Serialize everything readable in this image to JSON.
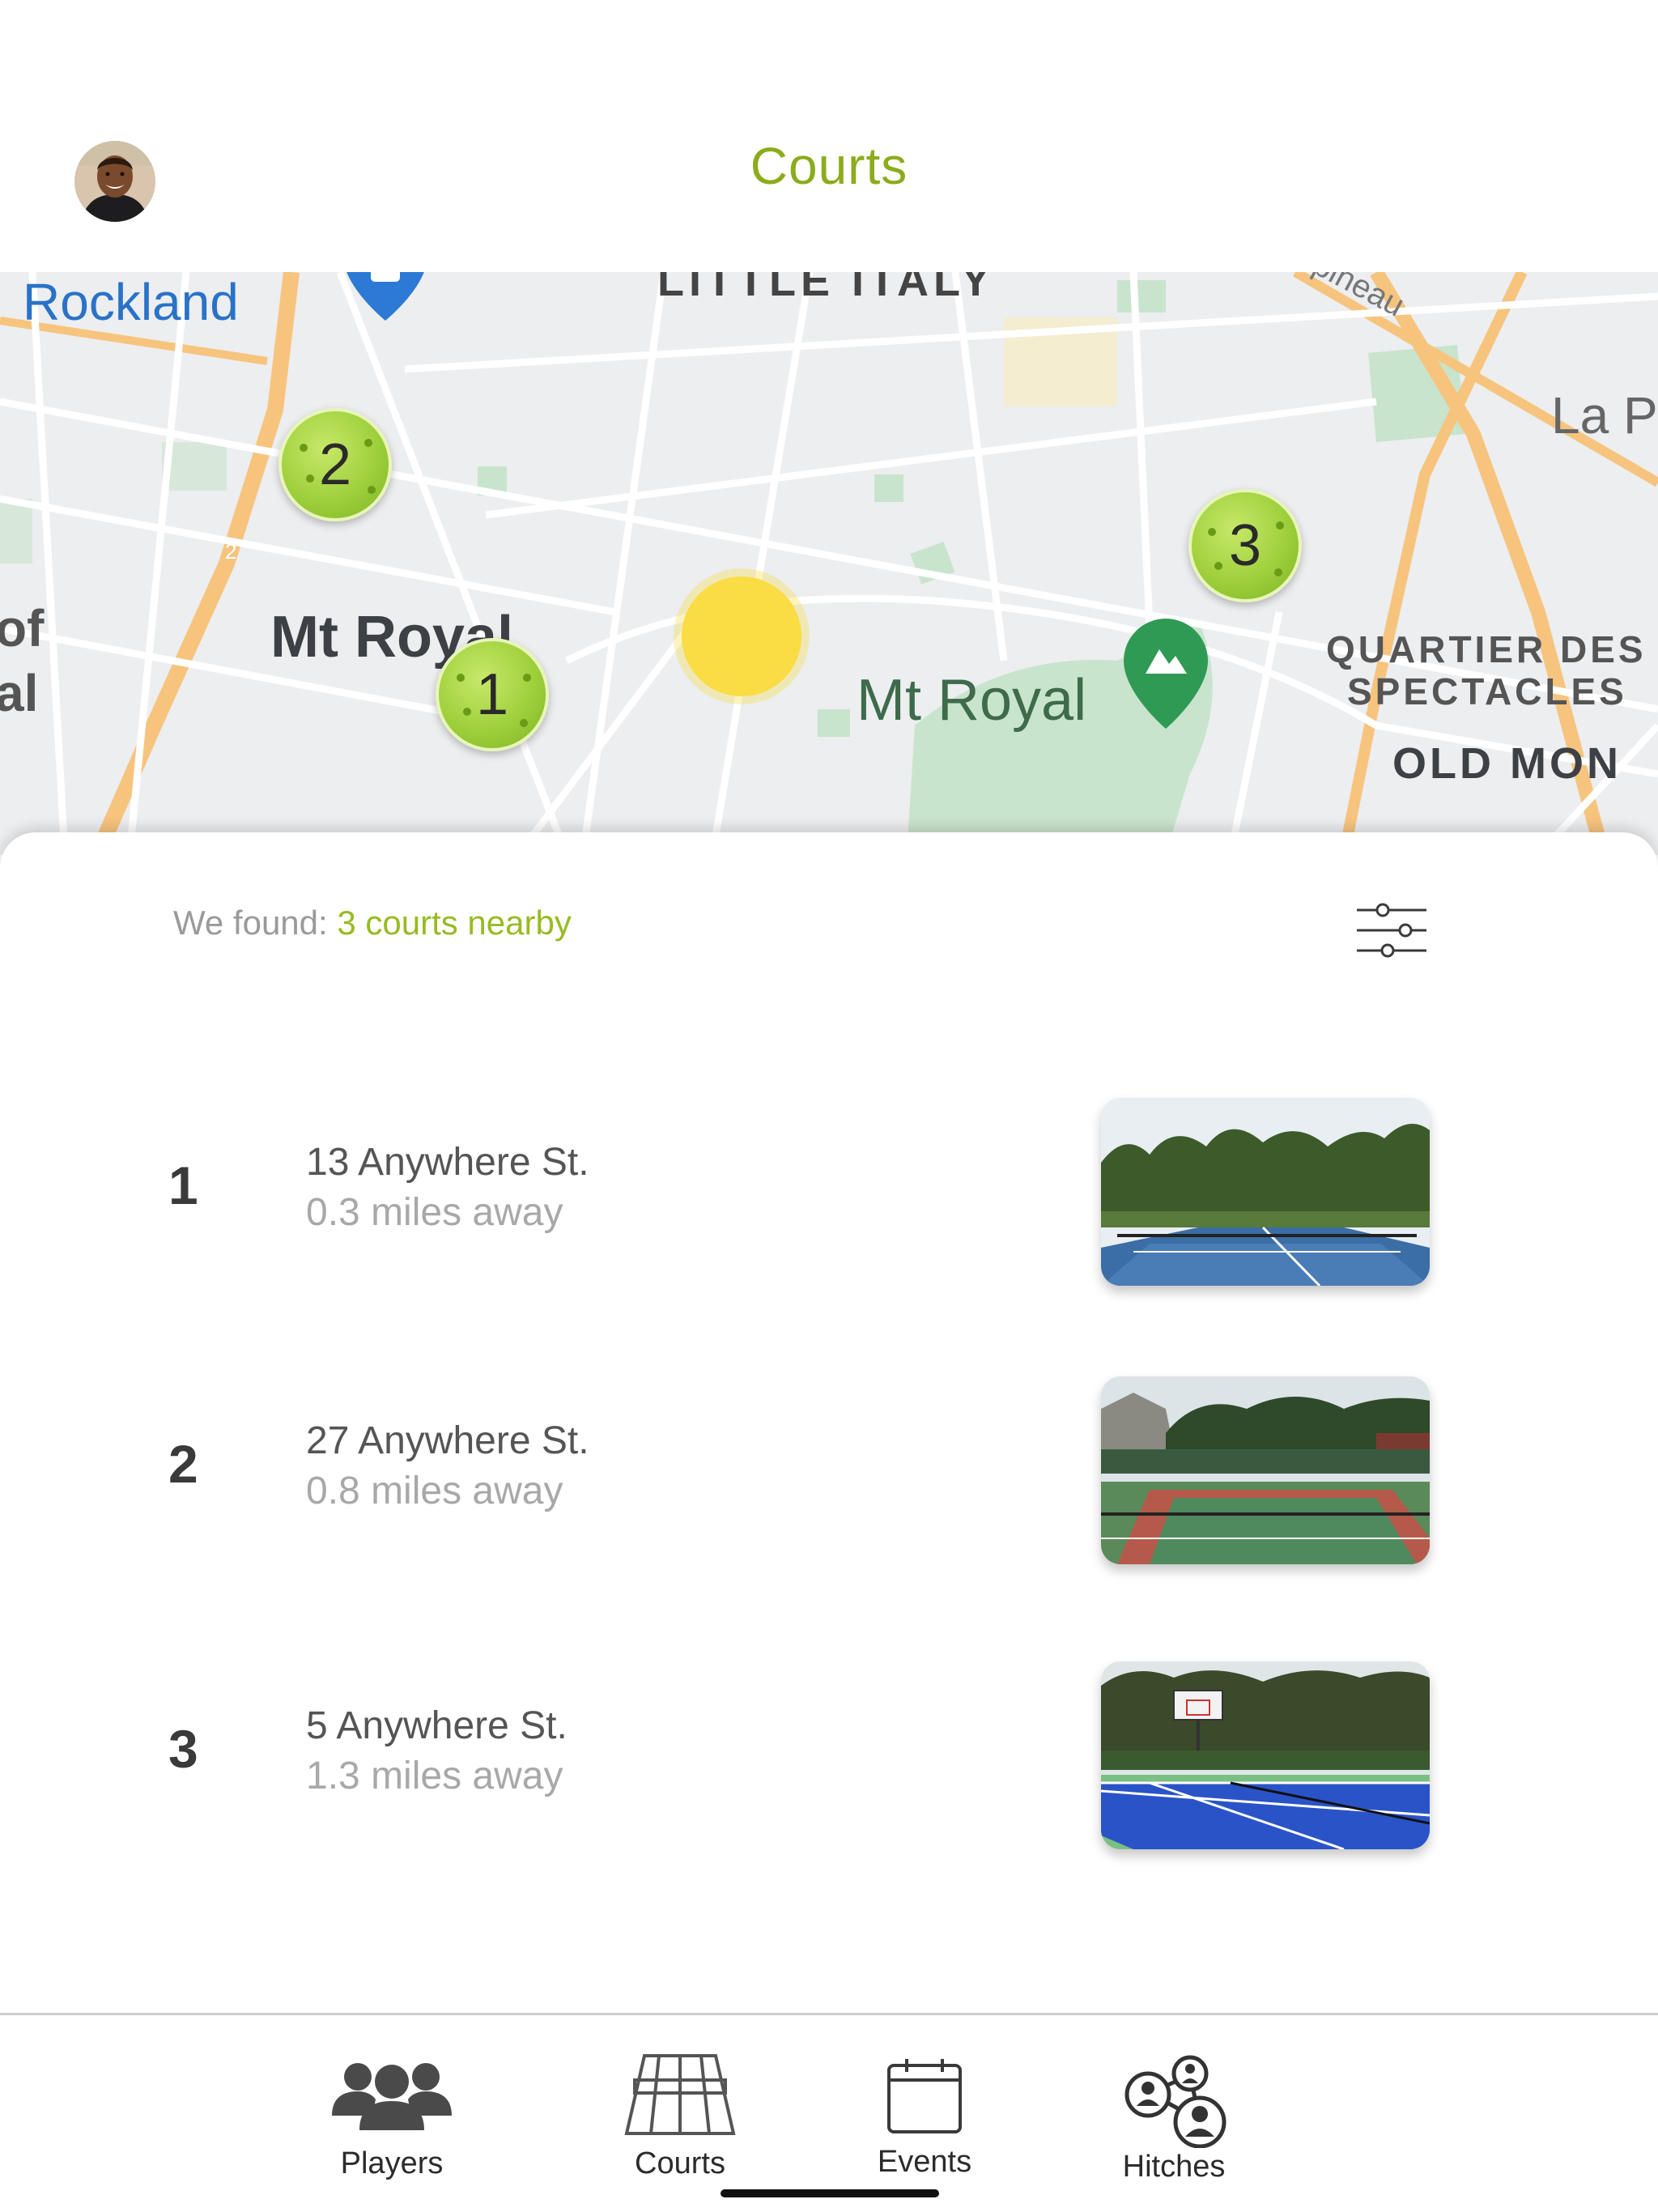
{
  "header": {
    "title": "Courts",
    "avatar_icon": "user-avatar"
  },
  "map": {
    "labels": {
      "rockland": "Rockland",
      "little_italy": "LITTLE ITALY",
      "mt_royal_left": "Mt Royal",
      "mt_royal_park": "Mt Royal",
      "quartier_1": "QUARTIER DES",
      "quartier_2": "SPECTACLES",
      "old_mon": "OLD MON",
      "la_p": "La P",
      "pineau": "pineau",
      "of": "of",
      "al": "al",
      "small_two": "2"
    },
    "markers": [
      {
        "label": "1"
      },
      {
        "label": "2"
      },
      {
        "label": "3"
      }
    ],
    "colors": {
      "marker": "#9ed03c",
      "user_location": "#fadc44",
      "park": "#cbe6cf",
      "road_major": "#f7c47e"
    }
  },
  "results": {
    "prefix": "We found: ",
    "count_text": "3 courts nearby",
    "filter_icon": "sliders-icon"
  },
  "courts": [
    {
      "number": "1",
      "address": "13 Anywhere St.",
      "distance": "0.3 miles away"
    },
    {
      "number": "2",
      "address": "27 Anywhere St.",
      "distance": "0.8 miles away"
    },
    {
      "number": "3",
      "address": "5 Anywhere St.",
      "distance": "1.3 miles away"
    }
  ],
  "tabs": [
    {
      "label": "Players",
      "icon": "people-icon"
    },
    {
      "label": "Courts",
      "icon": "court-icon"
    },
    {
      "label": "Events",
      "icon": "calendar-icon"
    },
    {
      "label": "Hitches",
      "icon": "network-icon"
    }
  ],
  "colors": {
    "accent": "#97bb22",
    "title": "#8bac1c"
  }
}
